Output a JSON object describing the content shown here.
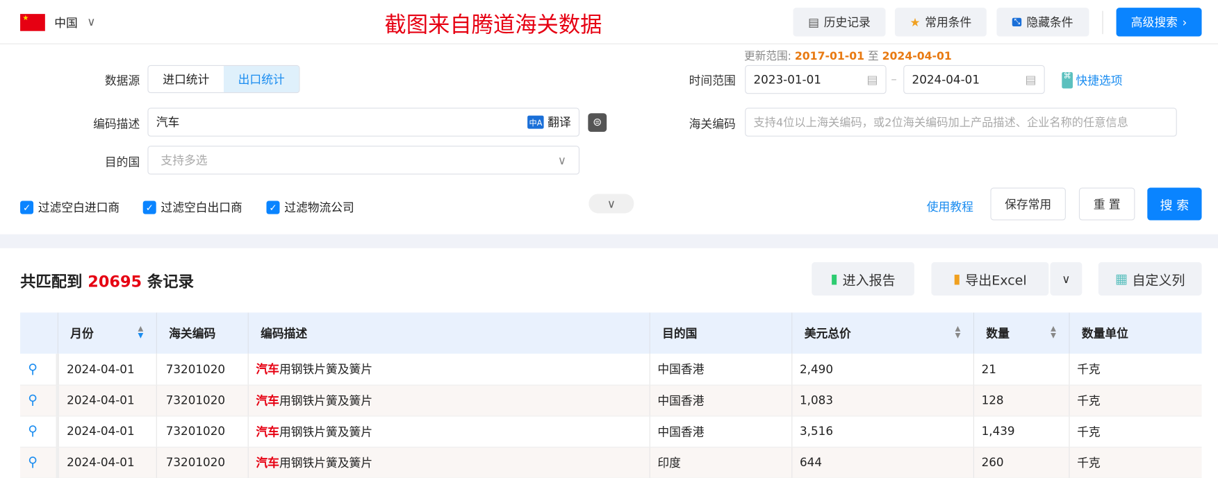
{
  "header": {
    "country": "中国",
    "watermark": "截图来自腾道海关数据",
    "buttons": [
      "历史记录",
      "常用条件",
      "隐藏条件"
    ],
    "advanced": "高级搜索",
    "colors": {
      "accent": "#0a84ff",
      "watermark": "#e60012"
    }
  },
  "form": {
    "update_label": "更新范围:",
    "update_from": "2017-01-01",
    "update_to_word": "至",
    "update_to": "2024-04-01",
    "source_label": "数据源",
    "source_options": [
      "进口统计",
      "出口统计"
    ],
    "source_selected": "出口统计",
    "desc_label": "编码描述",
    "desc_value": "汽车",
    "translate": "翻译",
    "dest_label": "目的国",
    "dest_placeholder": "支持多选",
    "time_label": "时间范围",
    "date_from": "2023-01-01",
    "date_to": "2024-04-01",
    "quick": "快捷选项",
    "hs_label": "海关编码",
    "hs_placeholder": "支持4位以上海关编码，或2位海关编码加上产品描述、企业名称的任意信息",
    "checks": [
      "过滤空白进口商",
      "过滤空白出口商",
      "过滤物流公司"
    ],
    "tutorial": "使用教程",
    "save": "保存常用",
    "reset": "重 置",
    "search": "搜 索"
  },
  "results": {
    "prefix": "共匹配到",
    "count": "20695",
    "suffix": "条记录",
    "report": "进入报告",
    "export": "导出Excel",
    "columns_btn": "自定义列"
  },
  "table": {
    "headers": [
      "月份",
      "海关编码",
      "编码描述",
      "目的国",
      "美元总价",
      "数量",
      "数量单位"
    ],
    "rows": [
      {
        "month": "2024-04-01",
        "code": "73201020",
        "kw": "汽车",
        "desc": "用钢铁片簧及簧片",
        "dest": "中国香港",
        "usd": "2,490",
        "qty": "21",
        "unit": "千克"
      },
      {
        "month": "2024-04-01",
        "code": "73201020",
        "kw": "汽车",
        "desc": "用钢铁片簧及簧片",
        "dest": "中国香港",
        "usd": "1,083",
        "qty": "128",
        "unit": "千克"
      },
      {
        "month": "2024-04-01",
        "code": "73201020",
        "kw": "汽车",
        "desc": "用钢铁片簧及簧片",
        "dest": "中国香港",
        "usd": "3,516",
        "qty": "1,439",
        "unit": "千克"
      },
      {
        "month": "2024-04-01",
        "code": "73201020",
        "kw": "汽车",
        "desc": "用钢铁片簧及簧片",
        "dest": "印度",
        "usd": "644",
        "qty": "260",
        "unit": "千克"
      }
    ]
  }
}
